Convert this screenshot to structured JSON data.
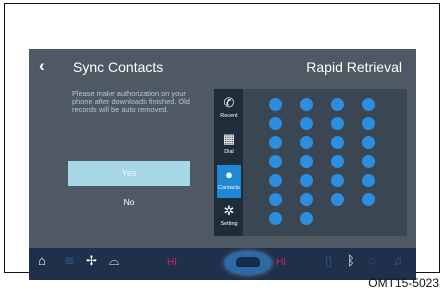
{
  "header": {
    "back_icon": "chevron-left-icon",
    "title": "Sync Contacts",
    "right_title": "Rapid Retrieval"
  },
  "dialog": {
    "message": "Please make authorization on your phone after downloads finished. Old records will be auto removed.",
    "yes_label": "Yes",
    "no_label": "No"
  },
  "side_menu": [
    {
      "label": "Recent",
      "icon": "phone-history-icon",
      "active": false
    },
    {
      "label": "Dial",
      "icon": "keypad-icon",
      "active": false
    },
    {
      "label": "Contacts",
      "icon": "person-icon",
      "active": true
    },
    {
      "label": "Setting",
      "icon": "gear-icon",
      "active": false
    }
  ],
  "status_bar": {
    "hi_left": "HI",
    "hi_right": "HI"
  },
  "caption": "OMT15-5023",
  "colors": {
    "screen_bg": "#4e5964",
    "panel_bg": "#3a4651",
    "accent": "#2b8ede",
    "yes_bg": "#a7d7e6",
    "hi_text": "#d0245b"
  }
}
